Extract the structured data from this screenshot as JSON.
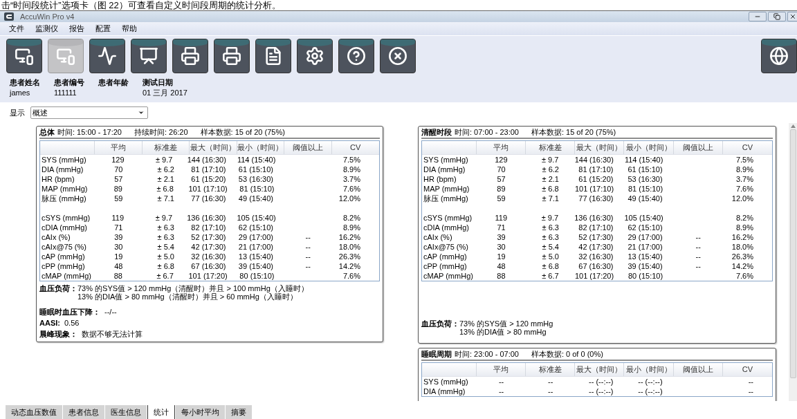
{
  "caption": "击“时间段统计”选项卡（图 22）可查看自定义时间段周期的统计分析。",
  "window": {
    "title": "AccuWin Pro v4"
  },
  "menu": [
    "文件",
    "监测仪",
    "报告",
    "配置",
    "帮助"
  ],
  "toolbar": [
    {
      "disabled": false
    },
    {
      "disabled": true
    },
    {
      "disabled": false
    },
    {
      "disabled": false
    },
    {
      "disabled": false
    },
    {
      "disabled": false
    },
    {
      "disabled": false
    },
    {
      "disabled": false
    },
    {
      "disabled": false
    },
    {
      "disabled": false
    },
    {
      "disabled": false
    }
  ],
  "patient": [
    {
      "label": "患者姓名",
      "value": "james"
    },
    {
      "label": "患者编号",
      "value": "111111"
    },
    {
      "label": "患者年龄"
    },
    {
      "label": "测试日期",
      "value": "01 三月 2017"
    }
  ],
  "display": {
    "label": "显示",
    "value": "概述"
  },
  "panels": [
    {
      "title": "总体",
      "time": "时间: 15:00 - 17:20",
      "duration": "持续时间: 26:20",
      "samples": "样本数据: 15 of 20 (75%)",
      "columns": [
        "平均",
        "标准差",
        "最大（时间）",
        "最小（时间）",
        "阈值以上",
        "CV"
      ],
      "row_groups": [
        [
          {
            "label": "SYS (mmHg)",
            "mean": "129",
            "sd": "± 9.7",
            "max": "144 (16:30)",
            "min": "114 (15:40)",
            "cv": "7.5%"
          },
          {
            "label": "DIA (mmHg)",
            "mean": "70",
            "sd": "± 6.2",
            "max": "81 (17:10)",
            "min": "61 (15:10)",
            "cv": "8.9%"
          },
          {
            "label": "HR (bpm)",
            "mean": "57",
            "sd": "± 2.1",
            "max": "61 (15:20)",
            "min": "53 (16:30)",
            "cv": "3.7%"
          },
          {
            "label": "MAP (mmHg)",
            "mean": "89",
            "sd": "± 6.8",
            "max": "101 (17:10)",
            "min": "81 (15:10)",
            "cv": "7.6%"
          },
          {
            "label": "脉压 (mmHg)",
            "mean": "59",
            "sd": "± 7.1",
            "max": "77 (16:30)",
            "min": "49 (15:40)",
            "cv": "12.0%"
          }
        ],
        [
          {
            "label": "cSYS (mmHg)",
            "mean": "119",
            "sd": "± 9.7",
            "max": "136 (16:30)",
            "min": "105 (15:40)",
            "cv": "8.2%"
          },
          {
            "label": "cDIA (mmHg)",
            "mean": "71",
            "sd": "± 6.3",
            "max": "82 (17:10)",
            "min": "62 (15:10)",
            "cv": "8.9%"
          },
          {
            "label": "cAIx (%)",
            "mean": "39",
            "sd": "± 6.3",
            "max": "52 (17:30)",
            "min": "29 (17:00)",
            "above": "--",
            "cv": "16.2%"
          },
          {
            "label": "cAIx@75 (%)",
            "mean": "30",
            "sd": "± 5.4",
            "max": "42 (17:30)",
            "min": "21 (17:00)",
            "above": "--",
            "cv": "18.0%"
          },
          {
            "label": "cAP (mmHg)",
            "mean": "19",
            "sd": "± 5.0",
            "max": "32 (16:30)",
            "min": "13 (15:40)",
            "above": "--",
            "cv": "26.3%"
          },
          {
            "label": "cPP (mmHg)",
            "mean": "48",
            "sd": "± 6.8",
            "max": "67 (16:30)",
            "min": "39 (15:40)",
            "above": "--",
            "cv": "14.2%"
          },
          {
            "label": "cMAP (mmHg)",
            "mean": "88",
            "sd": "± 6.7",
            "max": "101 (17:20)",
            "min": "80 (15:10)",
            "cv": "7.6%"
          }
        ]
      ],
      "bp_load": {
        "label": "血压负荷：",
        "lines": [
          "73% 的SYS值 > 120 mmHg（清醒时）并且 > 100 mmHg（入睡时）",
          "13% 的DIA值 > 80 mmHg（清醒时）并且 > 60 mmHg（入睡时）"
        ]
      },
      "extras": [
        {
          "label": "睡眠时血压下降：",
          "value": "--/--"
        },
        {
          "label": "AASI:",
          "value": "0.56"
        },
        {
          "label": "晨峰现象：",
          "value": "数据不够无法计算"
        }
      ]
    },
    {
      "title": "清醒时段",
      "time": "时间: 07:00 - 23:00",
      "samples": "样本数据: 15 of 20 (75%)",
      "columns": [
        "平均",
        "标准差",
        "最大（时间）",
        "最小（时间）",
        "阈值以上",
        "CV"
      ],
      "row_groups": [
        [
          {
            "label": "SYS (mmHg)",
            "mean": "129",
            "sd": "± 9.7",
            "max": "144 (16:30)",
            "min": "114 (15:40)",
            "cv": "7.5%"
          },
          {
            "label": "DIA (mmHg)",
            "mean": "70",
            "sd": "± 6.2",
            "max": "81 (17:10)",
            "min": "61 (15:10)",
            "cv": "8.9%"
          },
          {
            "label": "HR (bpm)",
            "mean": "57",
            "sd": "± 2.1",
            "max": "61 (15:20)",
            "min": "53 (16:30)",
            "cv": "3.7%"
          },
          {
            "label": "MAP (mmHg)",
            "mean": "89",
            "sd": "± 6.8",
            "max": "101 (17:10)",
            "min": "81 (15:10)",
            "cv": "7.6%"
          },
          {
            "label": "脉压 (mmHg)",
            "mean": "59",
            "sd": "± 7.1",
            "max": "77 (16:30)",
            "min": "49 (15:40)",
            "cv": "12.0%"
          }
        ],
        [
          {
            "label": "cSYS (mmHg)",
            "mean": "119",
            "sd": "± 9.7",
            "max": "136 (16:30)",
            "min": "105 (15:40)",
            "cv": "8.2%"
          },
          {
            "label": "cDIA (mmHg)",
            "mean": "71",
            "sd": "± 6.3",
            "max": "82 (17:10)",
            "min": "62 (15:10)",
            "cv": "8.9%"
          },
          {
            "label": "cAIx (%)",
            "mean": "39",
            "sd": "± 6.3",
            "max": "52 (17:30)",
            "min": "29 (17:00)",
            "above": "--",
            "cv": "16.2%"
          },
          {
            "label": "cAIx@75 (%)",
            "mean": "30",
            "sd": "± 5.4",
            "max": "42 (17:30)",
            "min": "21 (17:00)",
            "above": "--",
            "cv": "18.0%"
          },
          {
            "label": "cAP (mmHg)",
            "mean": "19",
            "sd": "± 5.0",
            "max": "32 (16:30)",
            "min": "13 (15:40)",
            "above": "--",
            "cv": "26.3%"
          },
          {
            "label": "cPP (mmHg)",
            "mean": "48",
            "sd": "± 6.8",
            "max": "67 (16:30)",
            "min": "39 (15:40)",
            "above": "--",
            "cv": "14.2%"
          },
          {
            "label": "cMAP (mmHg)",
            "mean": "88",
            "sd": "± 6.7",
            "max": "101 (17:20)",
            "min": "80 (15:10)",
            "cv": "7.6%"
          }
        ]
      ],
      "bp_load": {
        "label": "血压负荷：",
        "lines": [
          "73% 的SYS值 > 120 mmHg",
          "13% 的DIA值 > 80 mmHg"
        ]
      }
    },
    {
      "title": "睡眠周期",
      "time": "时间: 23:00 - 07:00",
      "samples": "样本数据: 0 of 0 (0%)",
      "columns": [
        "平均",
        "标准差",
        "最大（时间）",
        "最小（时间）",
        "阈值以上",
        "CV"
      ],
      "row_groups": [
        [
          {
            "label": "SYS (mmHg)",
            "mean": "--",
            "sd": "--",
            "max": "-- (--:--)",
            "min": "-- (--:--)",
            "cv": "--"
          },
          {
            "label": "DIA (mmHg)",
            "mean": "--",
            "sd": "--",
            "max": "-- (--:--)",
            "min": "-- (--:--)",
            "cv": "--"
          }
        ]
      ]
    }
  ],
  "tabs": [
    {
      "label": "动态血压数值",
      "selected": false
    },
    {
      "label": "患者信息",
      "selected": false
    },
    {
      "label": "医生信息",
      "selected": false
    },
    {
      "label": "统计",
      "selected": true
    },
    {
      "label": "每小时平均",
      "selected": false
    },
    {
      "label": "摘要",
      "selected": false
    }
  ]
}
